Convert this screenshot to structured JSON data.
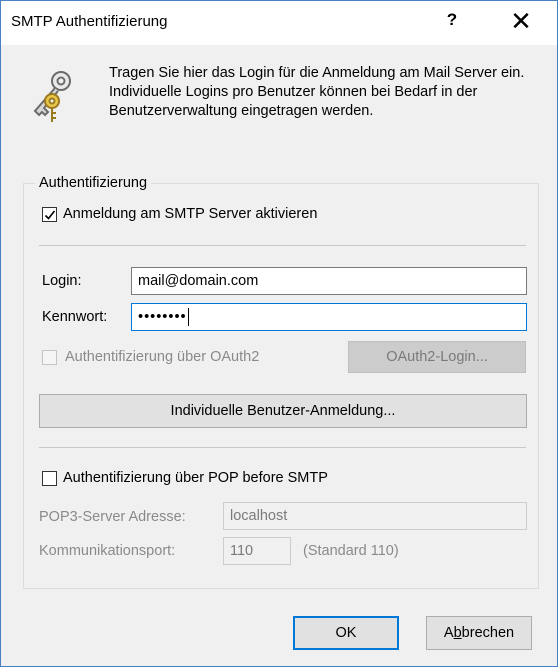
{
  "window": {
    "title": "SMTP Authentifizierung",
    "help_label": "?",
    "close_label": "✕"
  },
  "intro_text": "Tragen Sie hier das Login für die Anmeldung am Mail Server ein. Individuelle Logins pro Benutzer können bei Bedarf in der Benutzerverwaltung eingetragen werden.",
  "group": {
    "legend": "Authentifizierung",
    "smtp_auth": {
      "label": "Anmeldung am SMTP Server aktivieren",
      "checked": true
    },
    "login": {
      "label": "Login:",
      "value": "mail@domain.com"
    },
    "password": {
      "label": "Kennwort:",
      "value": "••••••••"
    },
    "oauth": {
      "label": "Authentifizierung über OAuth2",
      "checked": false,
      "enabled": false
    },
    "oauth_button": "OAuth2-Login...",
    "individual_button": "Individuelle Benutzer-Anmeldung...",
    "pop_before_smtp": {
      "label": "Authentifizierung über POP before SMTP",
      "checked": false
    },
    "pop3_server": {
      "label": "POP3-Server Adresse:",
      "value": "localhost"
    },
    "port": {
      "label": "Kommunikationsport:",
      "value": "110",
      "hint": "(Standard 110)"
    }
  },
  "buttons": {
    "ok": "OK",
    "cancel_prefix": "A",
    "cancel_access_key": "b",
    "cancel_suffix": "brechen"
  },
  "colors": {
    "accent": "#0078d7",
    "window_border": "#4a7fc0"
  }
}
